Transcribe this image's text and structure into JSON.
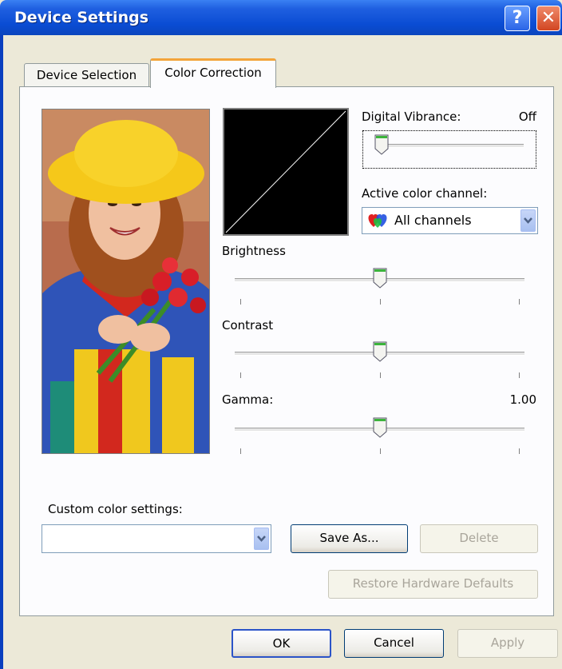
{
  "window": {
    "title": "Device Settings"
  },
  "tabs": [
    {
      "label": "Device Selection",
      "selected": false
    },
    {
      "label": "Color Correction",
      "selected": true
    }
  ],
  "digital_vibrance": {
    "label": "Digital Vibrance:",
    "value_text": "Off",
    "level": 0
  },
  "active_channel": {
    "label": "Active color channel:",
    "selected": "All channels"
  },
  "brightness": {
    "label": "Brightness",
    "level": 0.5
  },
  "contrast": {
    "label": "Contrast",
    "level": 0.5
  },
  "gamma": {
    "label": "Gamma:",
    "value_text": "1.00",
    "level": 0.5
  },
  "custom": {
    "label": "Custom color settings:",
    "value": ""
  },
  "buttons": {
    "save_as": "Save As...",
    "delete": "Delete",
    "restore": "Restore Hardware Defaults",
    "ok": "OK",
    "cancel": "Cancel",
    "apply": "Apply"
  },
  "colors": {
    "titlebar": "#0a4cd3",
    "tab_highlight": "#f3a43a",
    "thumb_green": "#3cb43c"
  }
}
